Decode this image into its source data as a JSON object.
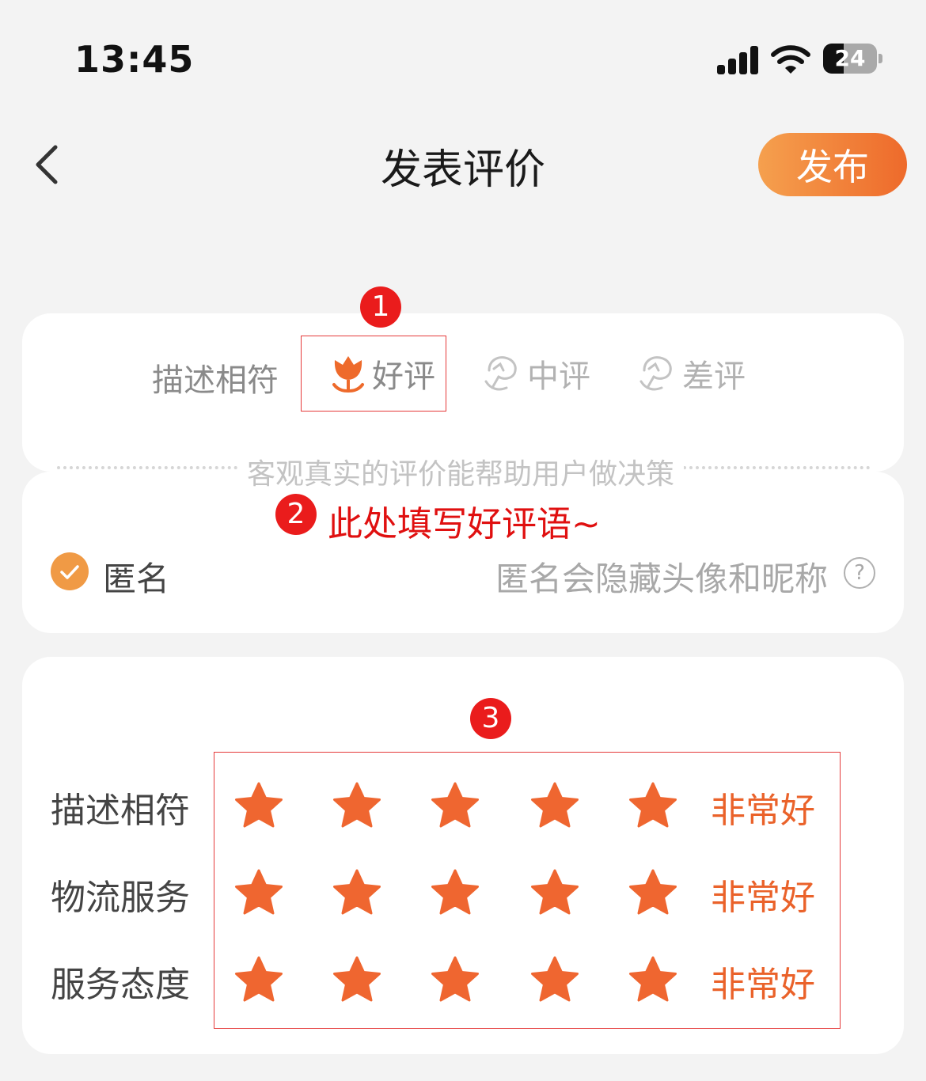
{
  "status_bar": {
    "time": "13:45",
    "battery": "24"
  },
  "header": {
    "title": "发表评价",
    "publish_label": "发布"
  },
  "review_type": {
    "label": "描述相符",
    "options": [
      {
        "label": "好评",
        "selected": true
      },
      {
        "label": "中评",
        "selected": false
      },
      {
        "label": "差评",
        "selected": false
      }
    ]
  },
  "comment": {
    "hint": "客观真实的评价能帮助用户做决策",
    "placeholder": "此处填写好评语~"
  },
  "anonymous": {
    "label": "匿名",
    "checked": true,
    "hint": "匿名会隐藏头像和昵称"
  },
  "ratings": [
    {
      "label": "描述相符",
      "stars": 5,
      "max": 5,
      "text": "非常好"
    },
    {
      "label": "物流服务",
      "stars": 5,
      "max": 5,
      "text": "非常好"
    },
    {
      "label": "服务态度",
      "stars": 5,
      "max": 5,
      "text": "非常好"
    }
  ],
  "annotations": [
    "1",
    "2",
    "3"
  ],
  "colors": {
    "accent": "#ee6a2b",
    "star": "#ef6630",
    "annotation": "#e53a3a"
  }
}
